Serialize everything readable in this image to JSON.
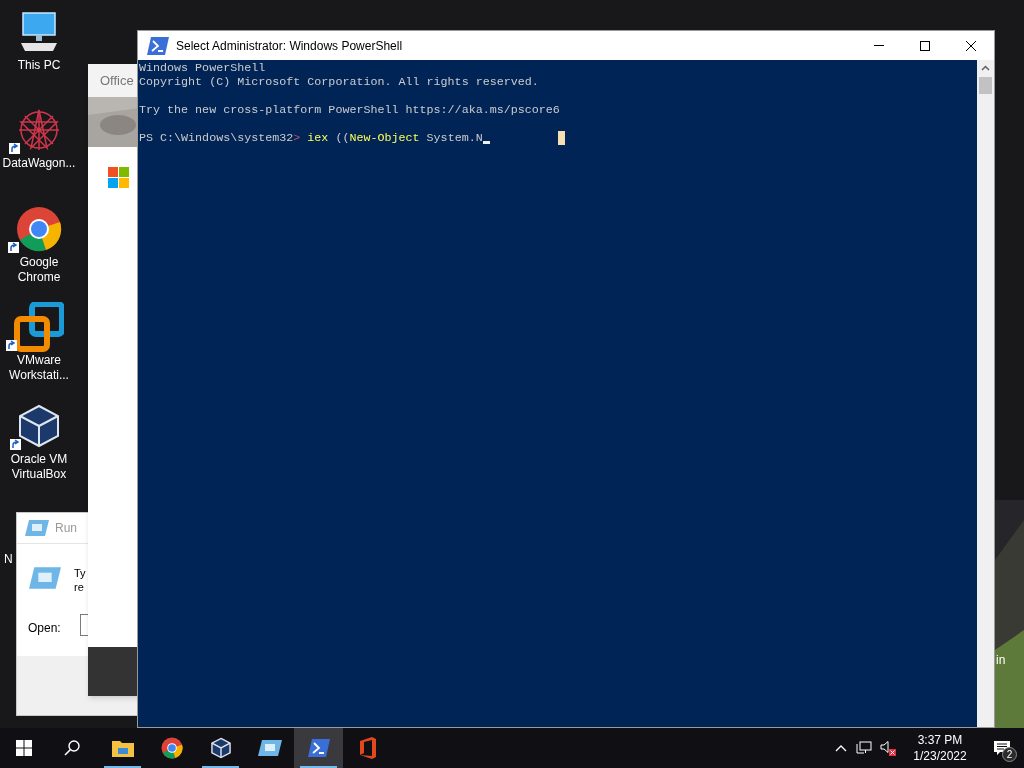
{
  "desktop_icons": [
    {
      "label": "This PC",
      "kind": "computer",
      "shortcut": false
    },
    {
      "label": "DataWagon...",
      "kind": "star",
      "shortcut": true
    },
    {
      "label": "Google Chrome",
      "kind": "chrome",
      "shortcut": true
    },
    {
      "label": "VMware Workstati...",
      "kind": "vmware",
      "shortcut": true
    },
    {
      "label": "Oracle VM VirtualBox",
      "kind": "cube",
      "shortcut": true
    }
  ],
  "desktop_fragments": [
    "N",
    "in"
  ],
  "office_window": {
    "title": "Office"
  },
  "run_dialog": {
    "title": "Run",
    "description": [
      "Ty",
      "re"
    ],
    "open_label": "Open:"
  },
  "powershell": {
    "title": "Select Administrator: Windows PowerShell",
    "lines": [
      {
        "kind": "text",
        "segments": [
          {
            "text": "Windows PowerShell",
            "kind": "plain"
          }
        ]
      },
      {
        "kind": "text",
        "segments": [
          {
            "text": "Copyright (C) Microsoft Corporation. All rights reserved.",
            "kind": "plain"
          }
        ]
      },
      {
        "kind": "blank"
      },
      {
        "kind": "text",
        "segments": [
          {
            "text": "Try the new cross-platform PowerShell https://aka.ms/pscore6",
            "kind": "plain"
          }
        ]
      },
      {
        "kind": "blank"
      },
      {
        "kind": "text",
        "segments": [
          {
            "text": "PS C:\\Windows\\system32",
            "kind": "plain"
          },
          {
            "text": ">",
            "kind": "operator"
          },
          {
            "text": " iex",
            "kind": "command"
          },
          {
            "text": " ((",
            "kind": "plain"
          },
          {
            "text": "New-Object",
            "kind": "command"
          },
          {
            "text": " System.N",
            "kind": "plain"
          }
        ]
      }
    ]
  },
  "taskbar": {
    "apps": [
      {
        "kind": "explorer",
        "running": true,
        "active": false
      },
      {
        "kind": "chrome",
        "running": false,
        "active": false
      },
      {
        "kind": "cube",
        "running": true,
        "active": false
      },
      {
        "kind": "run",
        "running": false,
        "active": false
      },
      {
        "kind": "powershell",
        "running": true,
        "active": true
      },
      {
        "kind": "office",
        "running": false,
        "active": false
      }
    ],
    "volume_muted": true,
    "time": "3:37 PM",
    "date": "1/23/2022",
    "notifications": "2"
  }
}
